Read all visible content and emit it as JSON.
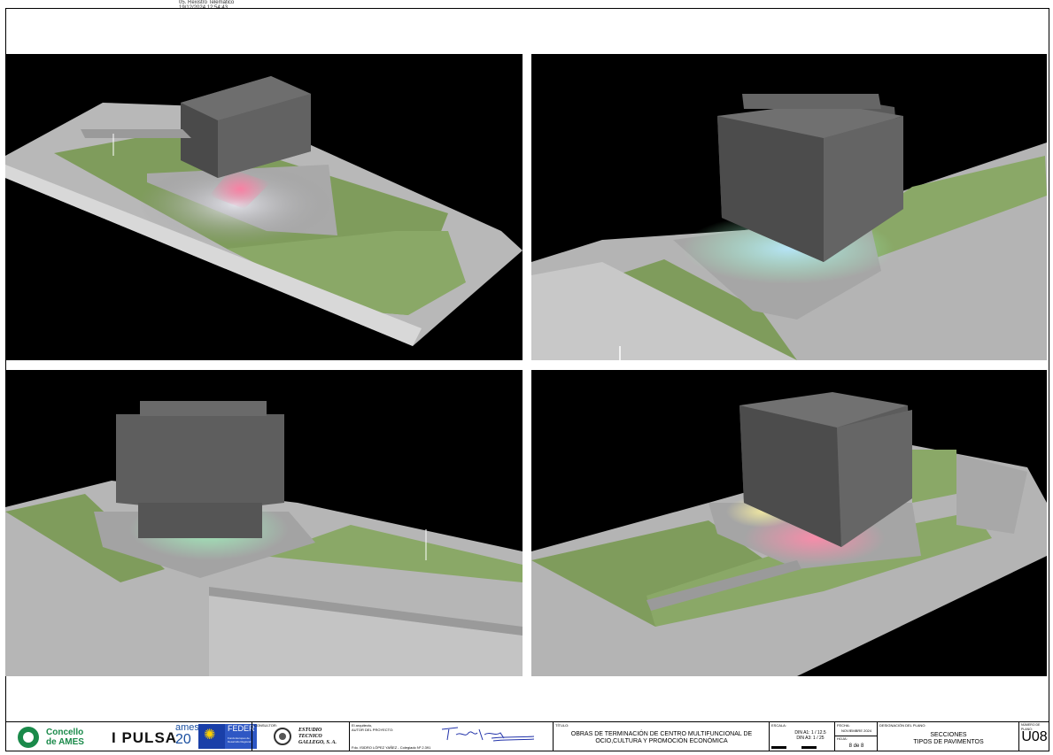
{
  "stamp": {
    "line1": "05. Rexistro Telemático",
    "line2": "19/12/2024 12:54:43"
  },
  "title_block": {
    "logo_ames": {
      "line1": "Concello",
      "line2": "de AMES",
      "color": "#1a8a4a"
    },
    "logo_impulsa": {
      "word": "I PULSA",
      "ames": "ames",
      "num": "20",
      "color": "#1a4fa0"
    },
    "logo_feder": {
      "title": "FEDER",
      "subtitle": "Fondo Europeo de Desarrollo Regional"
    },
    "consultor_label": "CONSULTOR:",
    "consultor_name": {
      "line1": "ESTUDIO",
      "line2": "TECNICO",
      "line3": "GALLEGO, S. A."
    },
    "architect_label": "El arquitecto,",
    "author_label": "AUTOR DEL PROYECTO:",
    "author_name": "Fdo. ISIDRO LÓPEZ YAÑEZ - Colegiado Nº 2.391",
    "titulo_label": "TÍTULO:",
    "titulo_line1": "OBRAS DE TERMINACIÓN DE CENTRO MULTIFUNCIONAL DE",
    "titulo_line2": "OCIO,CULTURA Y PROMOCIÓN ECONÓMICA",
    "escala_label": "ESCALA:",
    "escala_a1": "DIN A1: 1 / 12.5",
    "escala_a3": "DIN A3: 1 / 25",
    "fecha_label": "FECHA:",
    "fecha_value": "NOVIEMBRE 2024",
    "hoja_label": "HOJA:",
    "hoja_value": "8  de  8",
    "designacion_label": "DESIGNACIÓN DEL PLANO:",
    "designacion_line1": "SECCIONES",
    "designacion_line2": "TIPOS DE PAVIMENTOS",
    "numero_label": "NÚMERO DE PLANO:",
    "numero_value": "U08"
  }
}
